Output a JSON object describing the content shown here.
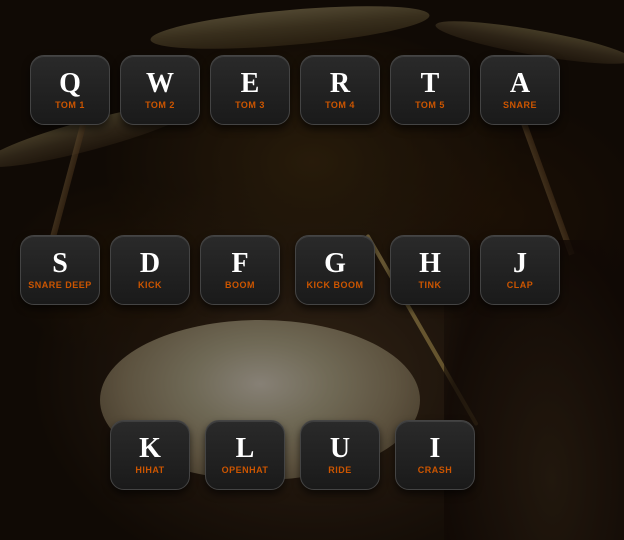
{
  "background": {
    "color": "#1a1008"
  },
  "rows": [
    {
      "id": "row1",
      "keys": [
        {
          "id": "q",
          "letter": "Q",
          "label": "TOM 1",
          "class": "key-q"
        },
        {
          "id": "w",
          "letter": "W",
          "label": "TOM 2",
          "class": "key-w"
        },
        {
          "id": "e",
          "letter": "E",
          "label": "TOM 3",
          "class": "key-e"
        },
        {
          "id": "r",
          "letter": "R",
          "label": "TOM 4",
          "class": "key-r"
        },
        {
          "id": "t",
          "letter": "T",
          "label": "TOM 5",
          "class": "key-t"
        },
        {
          "id": "a",
          "letter": "A",
          "label": "SNARE",
          "class": "key-a"
        }
      ]
    },
    {
      "id": "row2",
      "keys": [
        {
          "id": "s",
          "letter": "S",
          "label": "SNARE DEEP",
          "class": "key-s"
        },
        {
          "id": "d",
          "letter": "D",
          "label": "KICK",
          "class": "key-d"
        },
        {
          "id": "f",
          "letter": "F",
          "label": "BOOM",
          "class": "key-f"
        },
        {
          "id": "g",
          "letter": "G",
          "label": "KICK BOOM",
          "class": "key-g"
        },
        {
          "id": "h",
          "letter": "H",
          "label": "TINK",
          "class": "key-h"
        },
        {
          "id": "j",
          "letter": "J",
          "label": "CLAP",
          "class": "key-j"
        }
      ]
    },
    {
      "id": "row3",
      "keys": [
        {
          "id": "k",
          "letter": "K",
          "label": "HIHAT",
          "class": "key-k"
        },
        {
          "id": "l",
          "letter": "L",
          "label": "OPENHAT",
          "class": "key-l"
        },
        {
          "id": "u",
          "letter": "U",
          "label": "RIDE",
          "class": "key-u"
        },
        {
          "id": "i",
          "letter": "I",
          "label": "CRASH",
          "class": "key-i"
        }
      ]
    }
  ]
}
